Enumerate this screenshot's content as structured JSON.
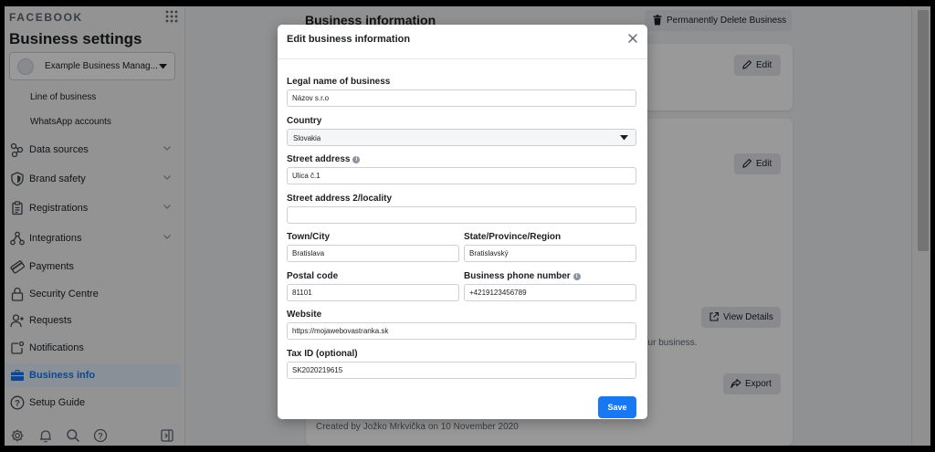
{
  "sidebar": {
    "wordmark": "FACEBOOK",
    "title": "Business settings",
    "business_selector": "Example Business Manag...",
    "sub_items": [
      "Line of business",
      "WhatsApp accounts"
    ],
    "nav": [
      {
        "label": "Data sources",
        "icon": "data-sources-icon",
        "expandable": true
      },
      {
        "label": "Brand safety",
        "icon": "shield-icon",
        "expandable": true
      },
      {
        "label": "Registrations",
        "icon": "clipboard-icon",
        "expandable": true
      },
      {
        "label": "Integrations",
        "icon": "integrations-icon",
        "expandable": true
      },
      {
        "label": "Payments",
        "icon": "credit-card-icon",
        "expandable": false
      },
      {
        "label": "Security Centre",
        "icon": "lock-icon",
        "expandable": false
      },
      {
        "label": "Requests",
        "icon": "person-add-icon",
        "expandable": false
      },
      {
        "label": "Notifications",
        "icon": "notification-icon",
        "expandable": false
      },
      {
        "label": "Business info",
        "icon": "briefcase-icon",
        "expandable": false,
        "active": true
      },
      {
        "label": "Setup Guide",
        "icon": "question-circle-icon",
        "expandable": false
      }
    ],
    "footer_icons": [
      "settings-icon",
      "bell-icon",
      "search-icon",
      "help-icon",
      "panel-toggle-icon"
    ]
  },
  "main": {
    "heading": "Business information",
    "delete_button": "Permanently Delete Business",
    "edit_button": "Edit",
    "view_details_button": "View Details",
    "export_button": "Export",
    "partial_text": "our business.",
    "created_by": "Created by Jožko Mrkvička on 10 November 2020"
  },
  "modal": {
    "title": "Edit business information",
    "fields": {
      "legal_name": {
        "label": "Legal name of business",
        "value": "Názov s.r.o"
      },
      "country": {
        "label": "Country",
        "value": "Slovakia"
      },
      "street": {
        "label": "Street address",
        "value": "Ulica č.1"
      },
      "street2": {
        "label": "Street address 2/locality",
        "value": ""
      },
      "town": {
        "label": "Town/City",
        "value": "Bratislava"
      },
      "state": {
        "label": "State/Province/Region",
        "value": "Bratislavský"
      },
      "postal": {
        "label": "Postal code",
        "value": "81101"
      },
      "phone": {
        "label": "Business phone number",
        "value": "+4219123456789"
      },
      "website": {
        "label": "Website",
        "value": "https://mojawebovastranka.sk"
      },
      "tax_id": {
        "label": "Tax ID (optional)",
        "value": "SK2020219615"
      }
    },
    "save_label": "Save"
  },
  "colors": {
    "accent": "#1877f2",
    "overlay": "rgba(0,0,0,0.4)",
    "sidebar_active_bg": "#e7f0fd"
  }
}
